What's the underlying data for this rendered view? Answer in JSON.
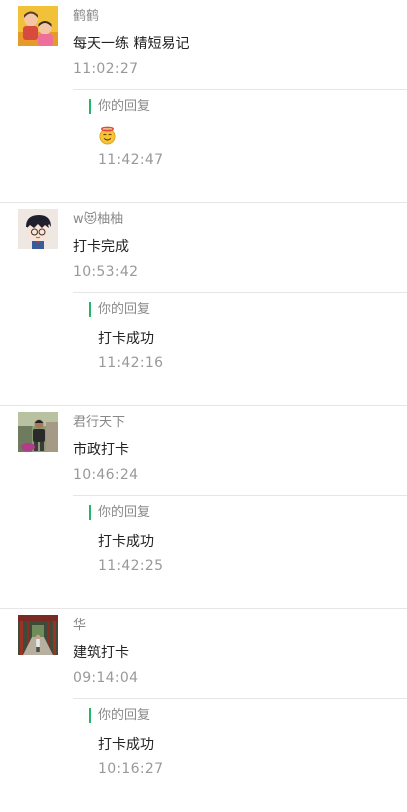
{
  "comments": [
    {
      "nickname": "鹤鹤",
      "avatar_icon": "kids-photo-avatar",
      "message": "每天一练 精短易记",
      "time": "11:02:27",
      "reply": {
        "label": "你的回复",
        "emoji": "smiling-face-with-halo-emoji",
        "text": "",
        "time": "11:42:47"
      }
    },
    {
      "nickname": "w😻柚柚",
      "avatar_icon": "cartoon-boy-avatar",
      "message": "打卡完成",
      "time": "10:53:42",
      "reply": {
        "label": "你的回复",
        "text": "打卡成功",
        "time": "11:42:16"
      }
    },
    {
      "nickname": "君行天下",
      "avatar_icon": "man-photo-avatar",
      "message": "市政打卡",
      "time": "10:46:24",
      "reply": {
        "label": "你的回复",
        "text": "打卡成功",
        "time": "11:42:25"
      }
    },
    {
      "nickname": "华",
      "avatar_icon": "corridor-photo-avatar",
      "message": "建筑打卡",
      "time": "09:14:04",
      "reply": {
        "label": "你的回复",
        "text": "打卡成功",
        "time": "10:16:27"
      }
    }
  ],
  "colors": {
    "reply_bar": "#21b66a",
    "nickname": "#888888",
    "time": "#999999",
    "divider": "#e6e6e6"
  }
}
